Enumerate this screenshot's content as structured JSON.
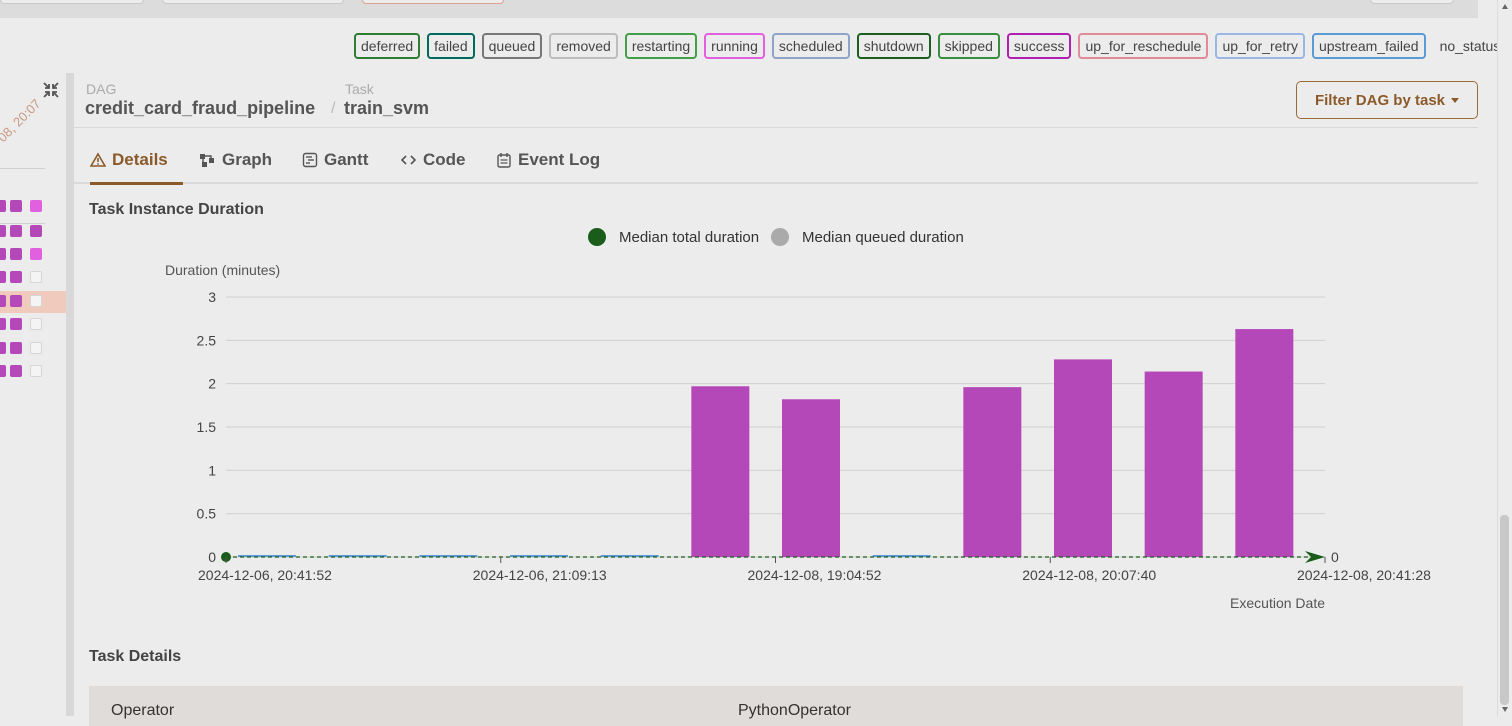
{
  "legend_states": [
    {
      "label": "deferred",
      "color": "#2e7d32"
    },
    {
      "label": "failed",
      "color": "#00695c"
    },
    {
      "label": "queued",
      "color": "#777777"
    },
    {
      "label": "removed",
      "color": "#bdbdbd"
    },
    {
      "label": "restarting",
      "color": "#43a047"
    },
    {
      "label": "running",
      "color": "#e060e0"
    },
    {
      "label": "scheduled",
      "color": "#90a4c8"
    },
    {
      "label": "shutdown",
      "color": "#1b5e20"
    },
    {
      "label": "skipped",
      "color": "#388e3c"
    },
    {
      "label": "success",
      "color": "#b020b0"
    },
    {
      "label": "up_for_reschedule",
      "color": "#e08a9a"
    },
    {
      "label": "up_for_retry",
      "color": "#9ab6e6"
    },
    {
      "label": "upstream_failed",
      "color": "#5b9bd5"
    },
    {
      "label": "no_status",
      "color": "transparent"
    }
  ],
  "left_panel": {
    "timestamp": "08, 20:07"
  },
  "breadcrumb": {
    "dag_label": "DAG",
    "dag_value": "credit_card_fraud_pipeline",
    "separator": "/",
    "task_label": "Task",
    "task_value": "train_svm"
  },
  "filter_button": "Filter DAG by task",
  "tabs": [
    {
      "label": "Details",
      "icon": "warning-triangle-icon"
    },
    {
      "label": "Graph",
      "icon": "graph-icon"
    },
    {
      "label": "Gantt",
      "icon": "gantt-icon"
    },
    {
      "label": "Code",
      "icon": "code-icon"
    },
    {
      "label": "Event Log",
      "icon": "calendar-icon"
    }
  ],
  "chart_section_title": "Task Instance Duration",
  "chart_data": {
    "type": "bar",
    "legend": [
      {
        "name": "Median total duration",
        "color": "#1a5c1a"
      },
      {
        "name": "Median queued duration",
        "color": "#aaaaaa"
      }
    ],
    "ylabel": "Duration (minutes)",
    "xlabel": "Execution Date",
    "ylim": [
      0,
      3
    ],
    "yticks": [
      "0",
      "0.5",
      "1",
      "1.5",
      "2",
      "2.5",
      "3"
    ],
    "xtick_labels": [
      "2024-12-06, 20:41:52",
      "2024-12-06, 21:09:13",
      "2024-12-08, 19:04:52",
      "2024-12-08, 20:07:40",
      "2024-12-08, 20:41:28"
    ],
    "right_axis_label": "0",
    "bar_color": "#b548b8",
    "empty_bar_color": "#5b9bd5",
    "values": [
      0,
      0,
      0,
      0,
      0,
      1.97,
      1.82,
      0,
      1.96,
      2.28,
      2.14,
      2.63
    ]
  },
  "task_details": {
    "title": "Task Details",
    "rows": [
      {
        "key": "Operator",
        "value": "PythonOperator"
      }
    ]
  }
}
